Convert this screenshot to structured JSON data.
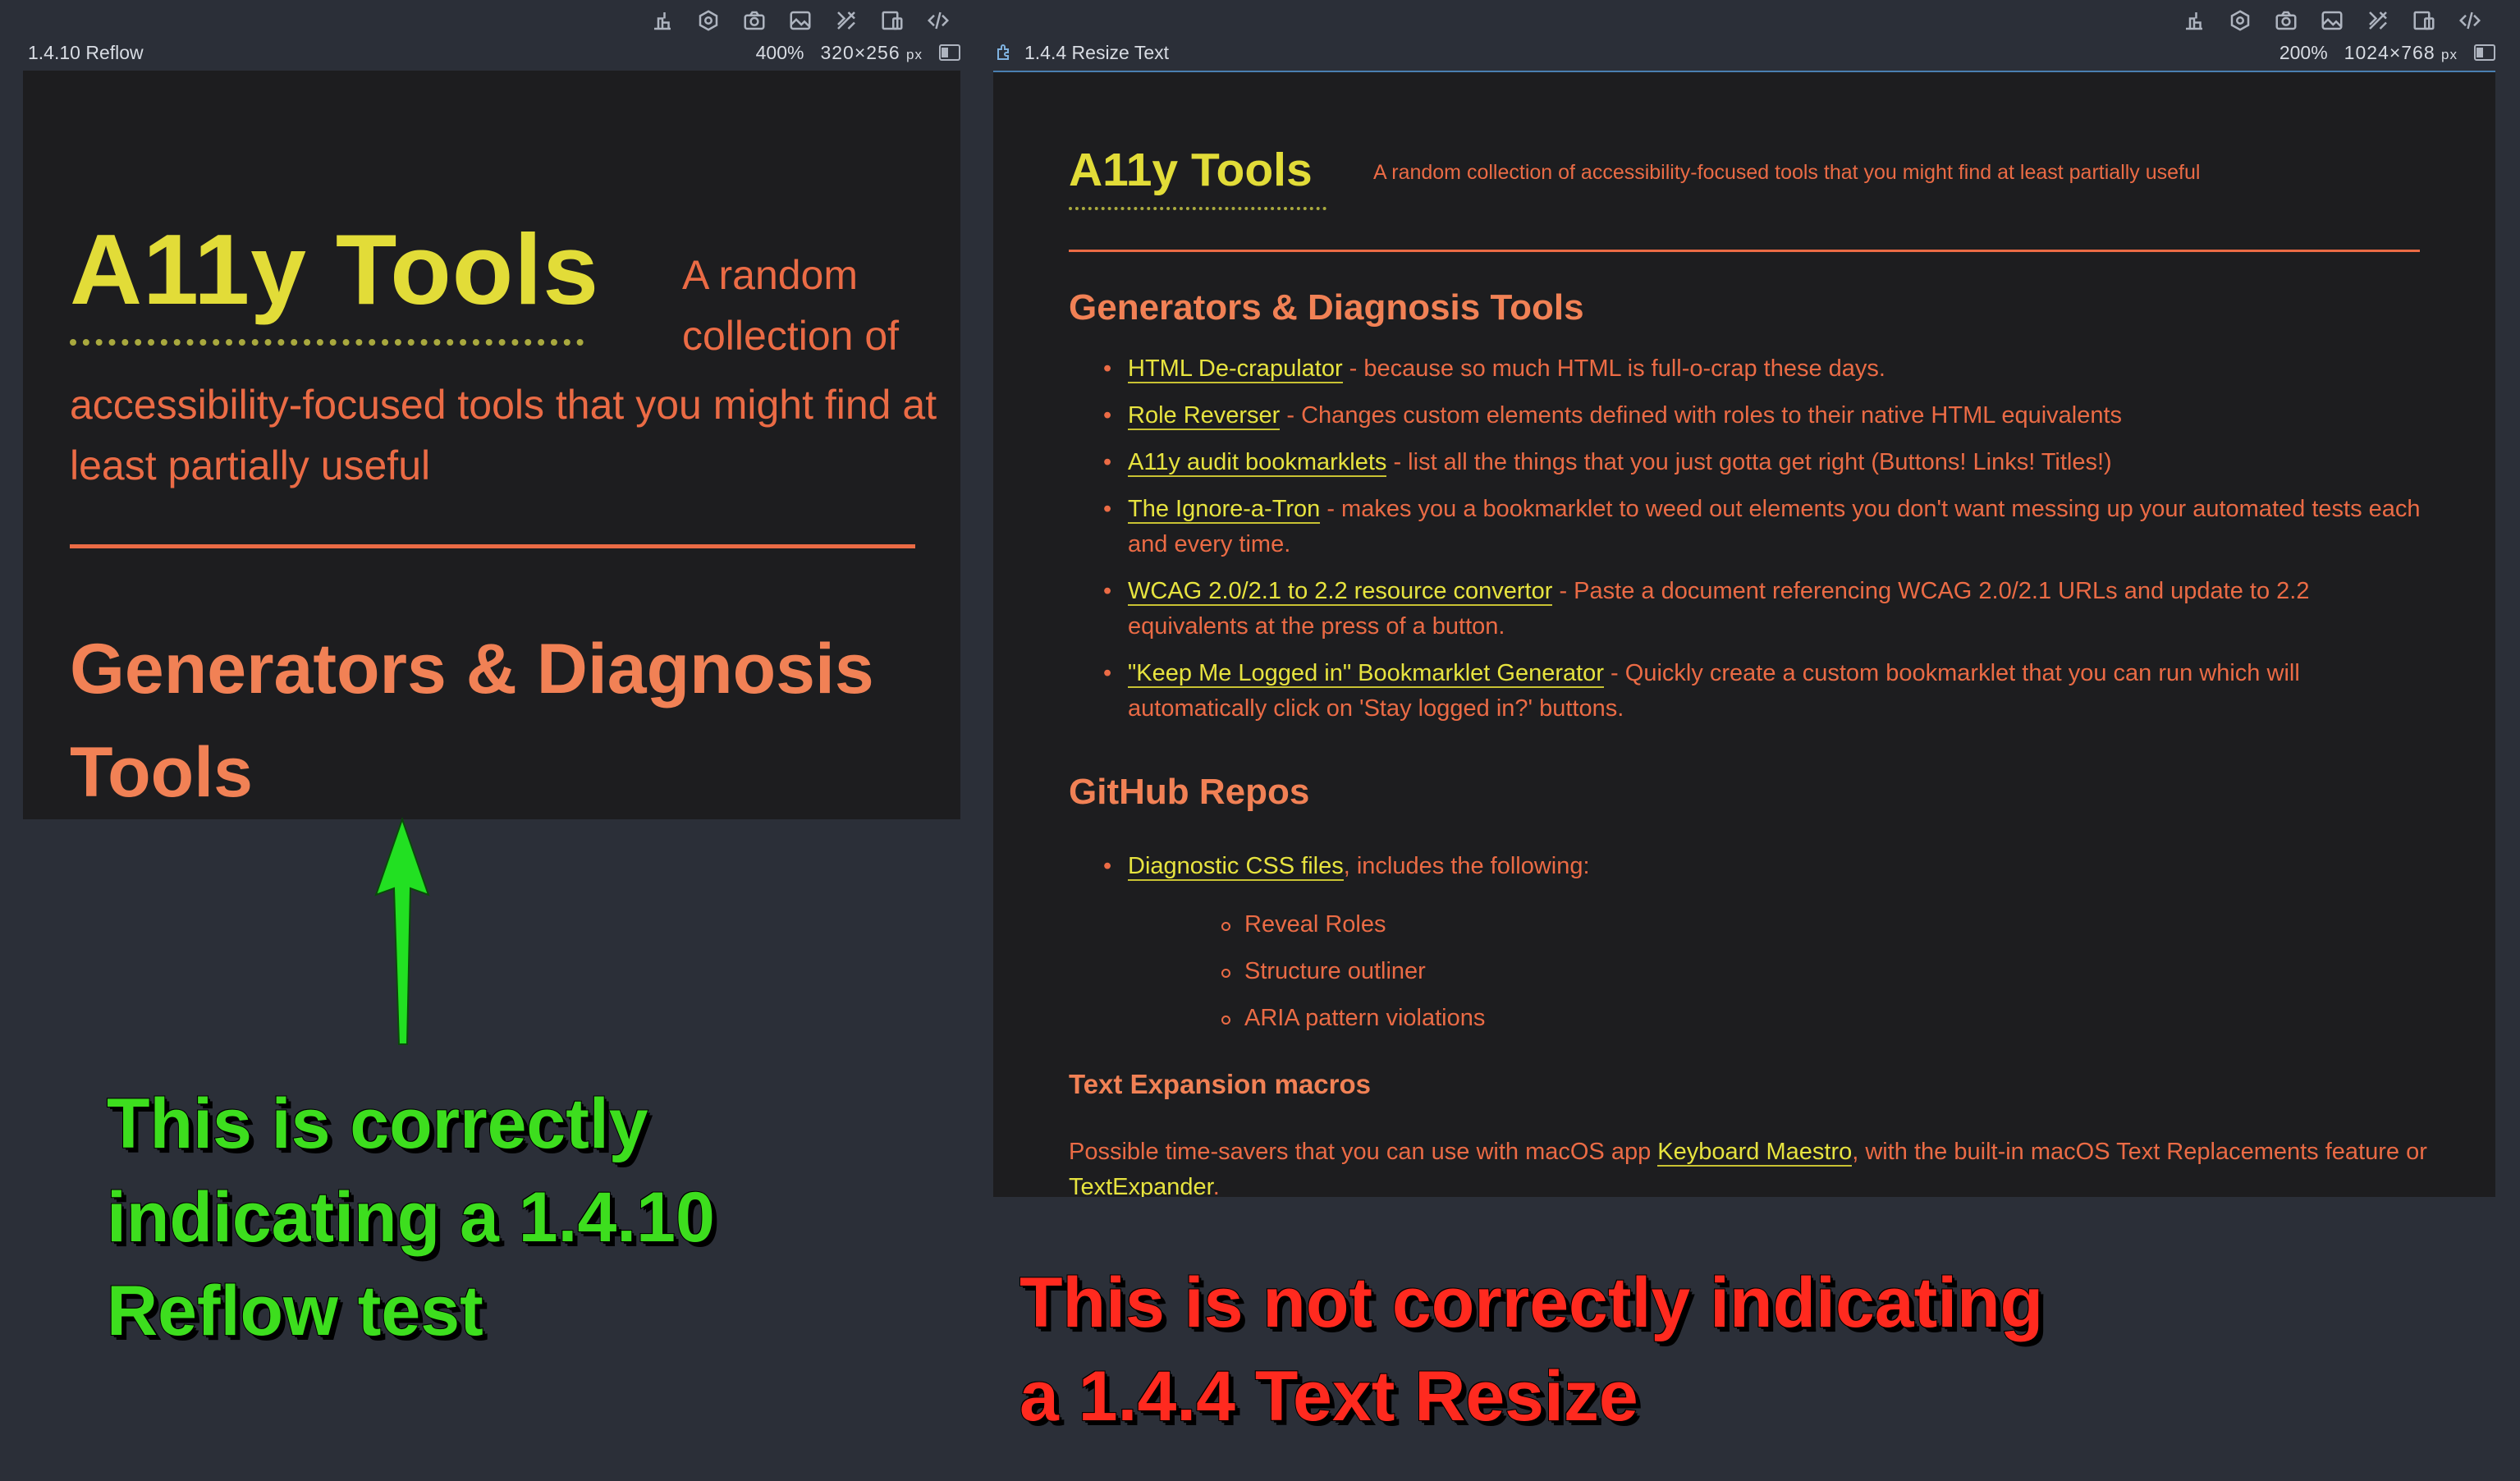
{
  "left_panel": {
    "name": "1.4.10 Reflow",
    "zoom": "400%",
    "dims": "320×256",
    "unit": "px",
    "toolbar_icons": [
      "layout-icon",
      "settings-icon",
      "camera-icon",
      "image-icon",
      "tools-icon",
      "devices-icon",
      "code-icon"
    ]
  },
  "right_panel": {
    "name": "1.4.4 Resize Text",
    "zoom": "200%",
    "dims": "1024×768",
    "unit": "px",
    "toolbar_icons": [
      "layout-icon",
      "settings-icon",
      "camera-icon",
      "image-icon",
      "tools-icon",
      "devices-icon",
      "code-icon"
    ]
  },
  "site": {
    "title": "A11y Tools",
    "tagline": "A random collection of accessibility-focused tools that you might find at least partially useful",
    "tagline_wrap_a": "A random collection of",
    "tagline_wrap_b": "accessibility-focused tools that you might find at least partially useful",
    "generators_heading": "Generators & Diagnosis Tools",
    "tools": [
      {
        "link": "HTML De-crapulator",
        "desc": " - because so much HTML is full-o-crap these days."
      },
      {
        "link": "Role Reverser",
        "desc": " - Changes custom elements defined with roles to their native HTML equivalents"
      },
      {
        "link": "A11y audit bookmarklets",
        "desc": " - list all the things that you just gotta get right (Buttons! Links! Titles!)"
      },
      {
        "link": "The Ignore-a-Tron",
        "desc": " - makes you a bookmarklet to weed out elements you don't want messing up your automated tests each and every time."
      },
      {
        "link": "WCAG 2.0/2.1 to 2.2 resource convertor",
        "desc": " - Paste a document referencing WCAG 2.0/2.1 URLs and update to 2.2 equivalents at the press of a button."
      },
      {
        "link": "\"Keep Me Logged in\" Bookmarklet Generator",
        "desc": " - Quickly create a custom bookmarklet that you can run which will automatically click on 'Stay logged in?' buttons."
      }
    ],
    "github_heading": "GitHub Repos",
    "repo": {
      "link": "Diagnostic CSS files",
      "desc": ", includes the following:"
    },
    "repo_items": [
      "Reveal Roles",
      "Structure outliner",
      "ARIA pattern violations"
    ],
    "text_expansion_heading": "Text Expansion macros",
    "para": {
      "text1": "Possible time-savers that you can use with macOS app ",
      "link1": "Keyboard Maestro",
      "text2": ", with the built-in macOS Text Replacements feature or ",
      "link2": "TextExpander",
      "text3": "."
    }
  },
  "annotations": {
    "left_note": "This is correctly indicating a 1.4.10 Reflow test",
    "right_note": "This is not correctly indicating a 1.4.4 Text Resize"
  },
  "colors": {
    "background": "#2b2f38",
    "frame": "#1d1d1f",
    "title_yellow": "#e2dc38",
    "text_orange": "#eb6b45",
    "heading_orange": "#f18155",
    "note_green": "#3dde1e",
    "note_red": "#ff2a1f"
  }
}
